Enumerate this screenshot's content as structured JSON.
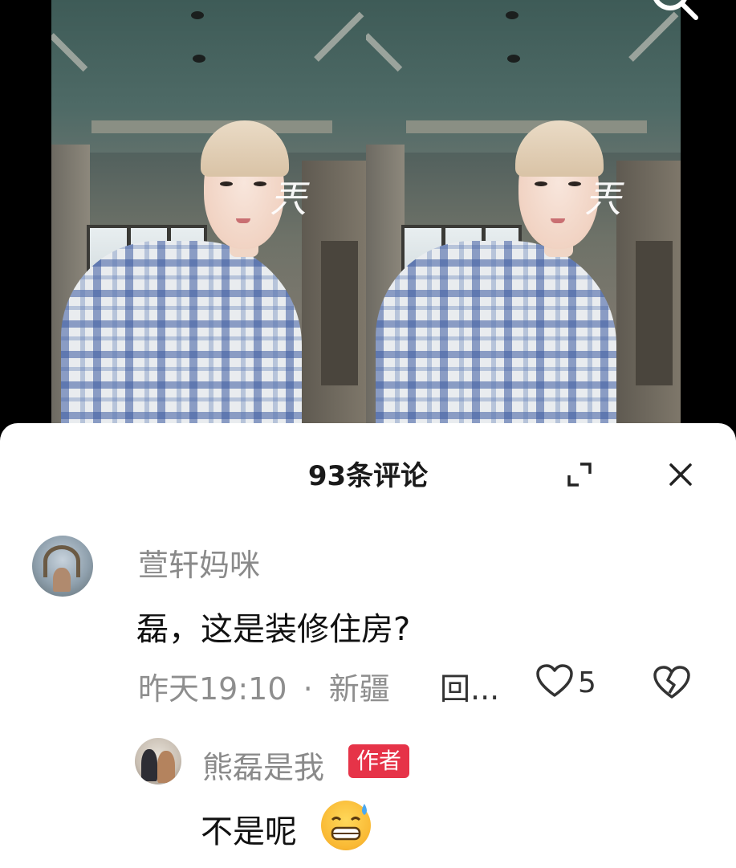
{
  "header": {
    "title": "93条评论"
  },
  "video": {
    "overlay_text": "兲"
  },
  "comments": [
    {
      "username": "萱轩妈咪",
      "text": "磊，这是装修住房?",
      "time": "昨天19:10",
      "separator": "·",
      "location": "新疆",
      "reply_label": "回...",
      "like_count": "5",
      "replies": [
        {
          "username": "熊磊是我",
          "badge": "作者",
          "text": "不是呢"
        }
      ]
    }
  ],
  "icons": {
    "search": "search-icon",
    "expand": "expand-icon",
    "close": "close-icon",
    "like": "heart-outline-icon",
    "dislike": "broken-heart-icon",
    "emoji": "sweat-grin-emoji"
  },
  "colors": {
    "badge": "#e63348",
    "username": "#8a8a8a",
    "text": "#111111"
  }
}
